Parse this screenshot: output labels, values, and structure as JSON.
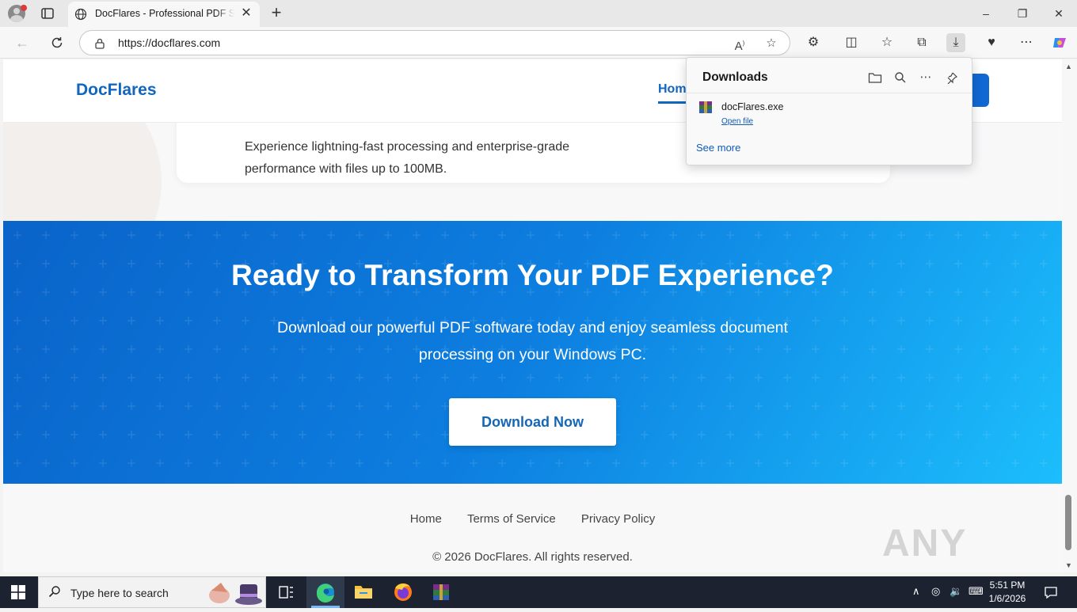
{
  "browser": {
    "tab_title": "DocFlares - Professional PDF Software",
    "url": "https://docflares.com",
    "window_controls": {
      "minimize": "–",
      "restore": "❐",
      "close": "✕"
    }
  },
  "site": {
    "brand": "DocFlares",
    "nav_home": "Home",
    "feature_line_partial": "Experience lightning-fast processing and enterprise-grade",
    "feature_line": "performance with files up to 100MB.",
    "cta": {
      "title": "Ready to Transform Your PDF Experience?",
      "subtitle": "Download our powerful PDF software today and enjoy seamless document processing on your Windows PC.",
      "button": "Download Now"
    },
    "footer": {
      "links": [
        "Home",
        "Terms of Service",
        "Privacy Policy"
      ],
      "copyright": "© 2026 DocFlares. All rights reserved."
    },
    "watermark": "ANY RUN"
  },
  "downloads": {
    "title": "Downloads",
    "file_name": "docFlares.exe",
    "open_file": "Open file",
    "see_more": "See more"
  },
  "taskbar": {
    "search_placeholder": "Type here to search",
    "time": "5:51 PM",
    "date": "1/6/2026"
  },
  "colors": {
    "brand": "#1166c0",
    "cta_gradient_start": "#0a63c9",
    "cta_gradient_end": "#1cbefc",
    "taskbar": "#1c2230"
  }
}
